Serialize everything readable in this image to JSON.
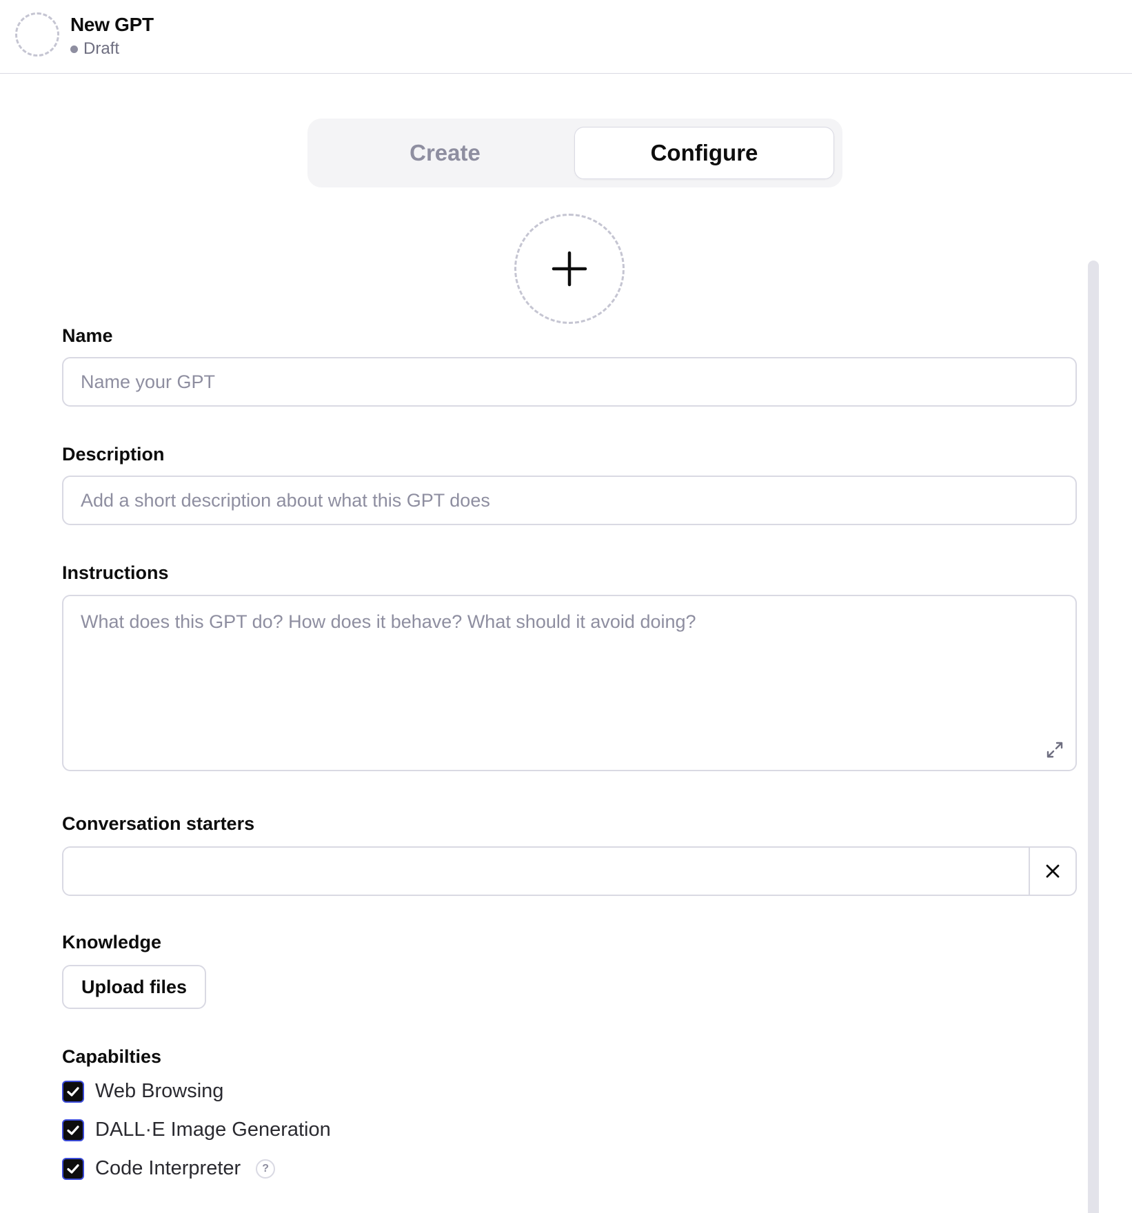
{
  "header": {
    "title": "New GPT",
    "status": "Draft"
  },
  "tabs": [
    {
      "label": "Create",
      "active": false
    },
    {
      "label": "Configure",
      "active": true
    }
  ],
  "form": {
    "name": {
      "label": "Name",
      "placeholder": "Name your GPT",
      "value": ""
    },
    "description": {
      "label": "Description",
      "placeholder": "Add a short description about what this GPT does",
      "value": ""
    },
    "instructions": {
      "label": "Instructions",
      "placeholder": "What does this GPT do? How does it behave? What should it avoid doing?",
      "value": ""
    },
    "conversation_starters": {
      "label": "Conversation starters",
      "items": [
        ""
      ]
    },
    "knowledge": {
      "label": "Knowledge",
      "upload_label": "Upload files"
    },
    "capabilities": {
      "label": "Capabilties",
      "items": [
        {
          "label": "Web Browsing",
          "checked": true
        },
        {
          "label": "DALL·E Image Generation",
          "checked": true
        },
        {
          "label": "Code Interpreter",
          "checked": true,
          "help": "?"
        }
      ]
    }
  },
  "colors": {
    "border": "#d9d9e3",
    "placeholder": "#8e8ea0",
    "checkbox_fill": "#0d0d0d",
    "checkbox_focus": "#3b4bd9"
  }
}
